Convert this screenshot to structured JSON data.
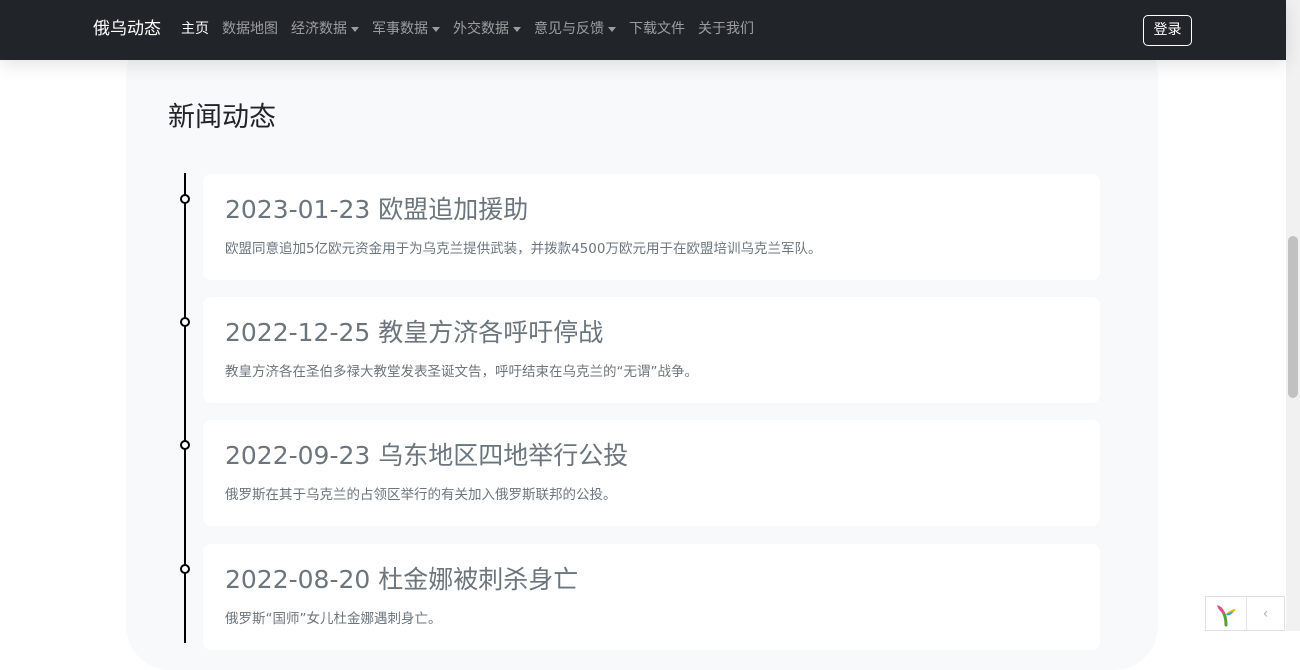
{
  "nav": {
    "brand": "俄乌动态",
    "items": [
      {
        "label": "主页",
        "active": true,
        "dropdown": false
      },
      {
        "label": "数据地图",
        "active": false,
        "dropdown": false
      },
      {
        "label": "经济数据",
        "active": false,
        "dropdown": true
      },
      {
        "label": "军事数据",
        "active": false,
        "dropdown": true
      },
      {
        "label": "外交数据",
        "active": false,
        "dropdown": true
      },
      {
        "label": "意见与反馈",
        "active": false,
        "dropdown": true
      },
      {
        "label": "下载文件",
        "active": false,
        "dropdown": false
      },
      {
        "label": "关于我们",
        "active": false,
        "dropdown": false
      }
    ],
    "login_label": "登录"
  },
  "news": {
    "title": "新闻动态",
    "items": [
      {
        "title": "2023-01-23 欧盟追加援助",
        "text": "欧盟同意追加5亿欧元资金用于为乌克兰提供武装，并拨款4500万欧元用于在欧盟培训乌克兰军队。"
      },
      {
        "title": "2022-12-25 教皇方济各呼吁停战",
        "text": "教皇方济各在圣伯多禄大教堂发表圣诞文告，呼吁结束在乌克兰的“无谓”战争。"
      },
      {
        "title": "2022-09-23 乌东地区四地举行公投",
        "text": "俄罗斯在其于乌克兰的占领区举行的有关加入俄罗斯联邦的公投。"
      },
      {
        "title": "2022-08-20 杜金娜被刺杀身亡",
        "text": "俄罗斯“国师”女儿杜金娜遇刺身亡。"
      }
    ]
  },
  "colors": {
    "navbar_bg": "#212529",
    "panel_bg": "#f8f9fa",
    "muted_text": "#6c757d"
  },
  "icons": {
    "widget_logo": "sprout-logo-icon",
    "widget_arrow": "chevron-left-icon",
    "dropdown": "caret-down-icon"
  }
}
